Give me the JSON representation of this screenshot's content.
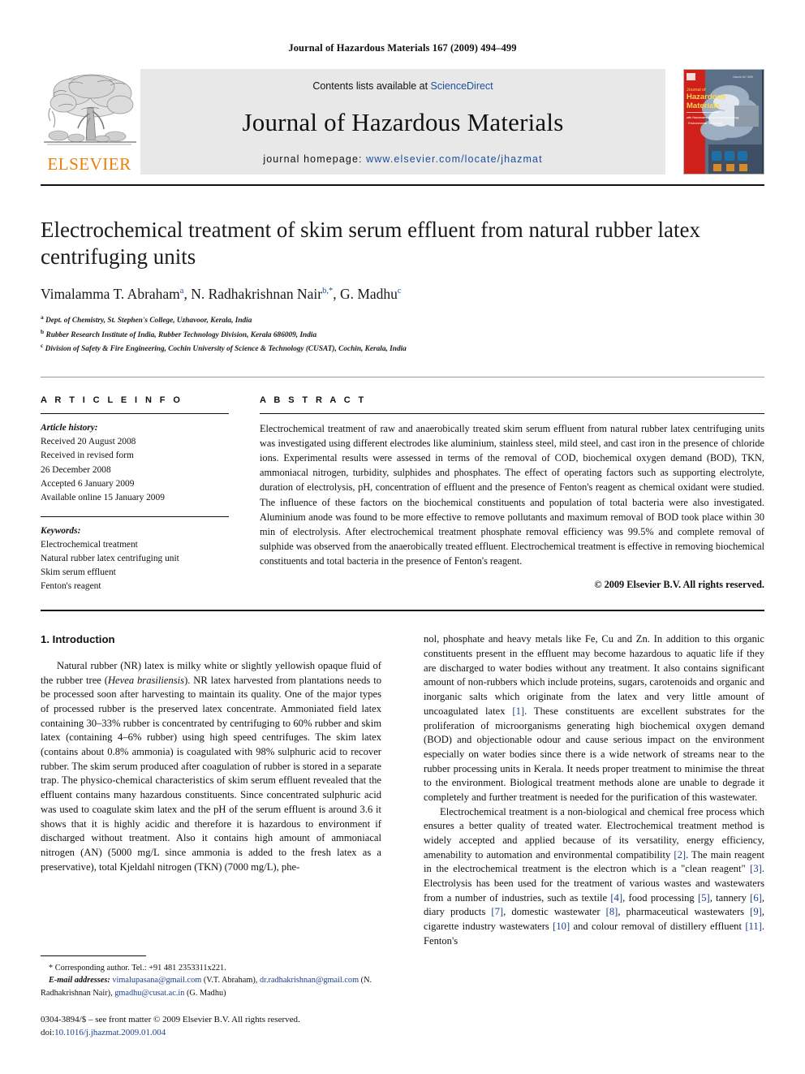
{
  "running_head": "Journal of Hazardous Materials 167 (2009) 494–499",
  "masthead": {
    "publisher_name": "ELSEVIER",
    "contents_prefix": "Contents lists available at ",
    "contents_link": "ScienceDirect",
    "journal_title": "Journal of Hazardous Materials",
    "homepage_prefix": "journal homepage: ",
    "homepage_url": "www.elsevier.com/locate/jhazmat",
    "cover": {
      "line1": "Journal of",
      "line2": "Hazardous",
      "line3": "Materials",
      "line4": "Including Nanomaterials and Nanotechnology",
      "line5": "Environmental Technology"
    }
  },
  "article": {
    "title": "Electrochemical treatment of skim serum effluent from natural rubber latex centrifuging units",
    "authors_html": "Vimalamma T. Abraham<sup>a</sup>, N. Radhakrishnan Nair<sup>b,*</sup>, G. Madhu<sup>c</sup>",
    "affiliations": [
      {
        "marker": "a",
        "text": "Dept. of Chemistry, St. Stephen's College, Uzhavoor, Kerala, India"
      },
      {
        "marker": "b",
        "text": "Rubber Research Institute of India, Rubber Technology Division, Kerala 686009, India"
      },
      {
        "marker": "c",
        "text": "Division of Safety & Fire Engineering, Cochin University of Science & Technology (CUSAT), Cochin, Kerala, India"
      }
    ]
  },
  "article_info": {
    "heading": "A R T I C L E   I N F O",
    "history_label": "Article history:",
    "history": [
      "Received 20 August 2008",
      "Received in revised form",
      "26 December 2008",
      "Accepted 6 January 2009",
      "Available online 15 January 2009"
    ],
    "keywords_label": "Keywords:",
    "keywords": [
      "Electrochemical treatment",
      "Natural rubber latex centrifuging unit",
      "Skim serum effluent",
      "Fenton's reagent"
    ]
  },
  "abstract": {
    "heading": "A B S T R A C T",
    "text": "Electrochemical treatment of raw and anaerobically treated skim serum effluent from natural rubber latex centrifuging units was investigated using different electrodes like aluminium, stainless steel, mild steel, and cast iron in the presence of chloride ions. Experimental results were assessed in terms of the removal of COD, biochemical oxygen demand (BOD), TKN, ammoniacal nitrogen, turbidity, sulphides and phosphates. The effect of operating factors such as supporting electrolyte, duration of electrolysis, pH, concentration of effluent and the presence of Fenton's reagent as chemical oxidant were studied. The influence of these factors on the biochemical constituents and population of total bacteria were also investigated. Aluminium anode was found to be more effective to remove pollutants and maximum removal of BOD took place within 30 min of electrolysis. After electrochemical treatment phosphate removal efficiency was 99.5% and complete removal of sulphide was observed from the anaerobically treated effluent. Electrochemical treatment is effective in removing biochemical constituents and total bacteria in the presence of Fenton's reagent.",
    "copyright": "© 2009 Elsevier B.V. All rights reserved."
  },
  "body": {
    "section_title": "1.  Introduction",
    "left_paragraphs": [
      "Natural rubber (NR) latex is milky white or slightly yellowish opaque fluid of the rubber tree (Hevea brasiliensis). NR latex harvested from plantations needs to be processed soon after harvesting to maintain its quality. One of the major types of processed rubber is the preserved latex concentrate. Ammoniated field latex containing 30–33% rubber is concentrated by centrifuging to 60% rubber and skim latex (containing 4–6% rubber) using high speed centrifuges. The skim latex (contains about 0.8% ammonia) is coagulated with 98% sulphuric acid to recover rubber. The skim serum produced after coagulation of rubber is stored in a separate trap. The physico-chemical characteristics of skim serum effluent revealed that the effluent contains many hazardous constituents. Since concentrated sulphuric acid was used to coagulate skim latex and the pH of the serum effluent is around 3.6 it shows that it is highly acidic and therefore it is hazardous to environment if discharged without treatment. Also it contains high amount of ammoniacal nitrogen (AN) (5000 mg/L since ammonia is added to the fresh latex as a preservative), total Kjeldahl nitrogen (TKN) (7000 mg/L), phe-"
    ],
    "right_paragraphs": [
      "nol, phosphate and heavy metals like Fe, Cu and Zn. In addition to this organic constituents present in the effluent may become hazardous to aquatic life if they are discharged to water bodies without any treatment. It also contains significant amount of non-rubbers which include proteins, sugars, carotenoids and organic and inorganic salts which originate from the latex and very little amount of uncoagulated latex [1]. These constituents are excellent substrates for the proliferation of microorganisms generating high biochemical oxygen demand (BOD) and objectionable odour and cause serious impact on the environment especially on water bodies since there is a wide network of streams near to the rubber processing units in Kerala. It needs proper treatment to minimise the threat to the environment. Biological treatment methods alone are unable to degrade it completely and further treatment is needed for the purification of this wastewater.",
      "Electrochemical treatment is a non-biological and chemical free process which ensures a better quality of treated water. Electrochemical treatment method is widely accepted and applied because of its versatility, energy efficiency, amenability to automation and environmental compatibility [2]. The main reagent in the electrochemical treatment is the electron which is a \"clean reagent\" [3]. Electrolysis has been used for the treatment of various wastes and wastewaters from a number of industries, such as textile [4], food processing [5], tannery [6], diary products [7], domestic wastewater [8], pharmaceutical wastewaters [9], cigarette industry wastewaters [10] and colour removal of distillery effluent [11]. Fenton's"
    ]
  },
  "footnotes": {
    "corresponding": "*  Corresponding author. Tel.: +91 481 2353311x221.",
    "email_label": "E-mail addresses:",
    "emails": [
      {
        "address": "vimalupasana@gmail.com",
        "owner": "(V.T. Abraham)"
      },
      {
        "address": "dr.radhakrishnan@gmail.com",
        "owner": "(N. Radhakrishnan Nair)"
      },
      {
        "address": "gmadhu@cusat.ac.in",
        "owner": "(G. Madhu)"
      }
    ],
    "issn_line": "0304-3894/$ – see front matter © 2009 Elsevier B.V. All rights reserved.",
    "doi_label": "doi:",
    "doi_value": "10.1016/j.jhazmat.2009.01.004"
  },
  "colors": {
    "elsevier_orange": "#f07c00",
    "link_blue": "#1a4f9c",
    "ref_blue": "#1a3f8f",
    "masthead_grey": "#e8e8e8",
    "cover_red": "#d0201a"
  }
}
